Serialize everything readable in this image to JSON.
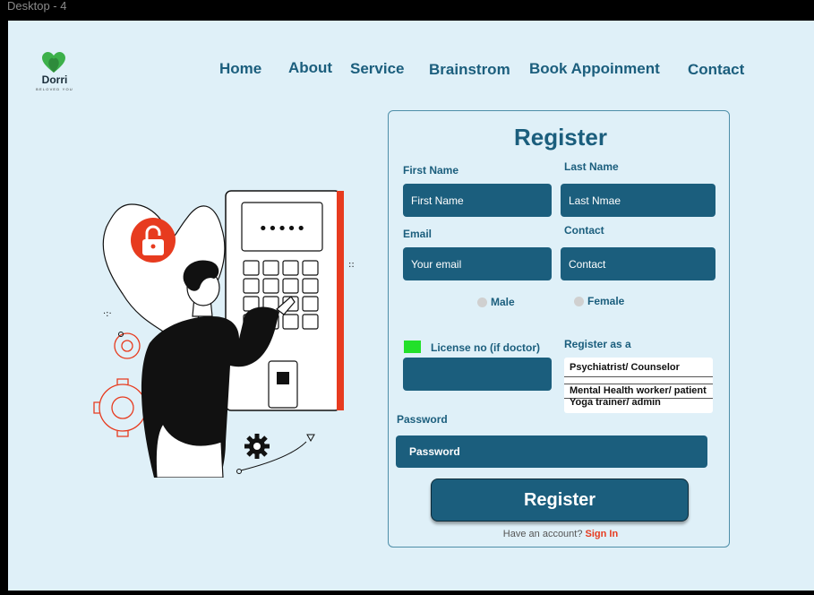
{
  "frame": {
    "label": "Desktop - 4"
  },
  "logo": {
    "name": "Dorri",
    "tagline": "BELOVED YOU"
  },
  "nav": {
    "items": [
      {
        "label": "Home"
      },
      {
        "label": "About"
      },
      {
        "label": "Service"
      },
      {
        "label": "Brainstrom"
      },
      {
        "label": "Book Appoinment"
      },
      {
        "label": "Contact"
      }
    ]
  },
  "form": {
    "title": "Register",
    "first_name": {
      "label": "First Name",
      "placeholder": "First Name"
    },
    "last_name": {
      "label": "Last Name",
      "placeholder": "Last Nmae"
    },
    "email": {
      "label": "Email",
      "placeholder": "Your email"
    },
    "contact": {
      "label": "Contact",
      "placeholder": "Contact"
    },
    "gender": {
      "male": "Male",
      "female": "Female"
    },
    "license": {
      "label": "License no  (if doctor)"
    },
    "register_as": {
      "label": "Register as a",
      "options": [
        "Psychiatrist/ Counselor",
        "Mental Health worker/ patient",
        "Yoga trainer/ admin"
      ]
    },
    "password": {
      "label": "Password",
      "placeholder": "Password"
    },
    "submit_label": "Register",
    "footer": {
      "text": "Have an account?",
      "link": "Sign In"
    }
  },
  "illustration": {
    "keypad_display": "•••••"
  },
  "colors": {
    "background": "#dff0f8",
    "primary": "#1b5e7d",
    "accent": "#e73b1f",
    "checkbox": "#22e02a"
  }
}
